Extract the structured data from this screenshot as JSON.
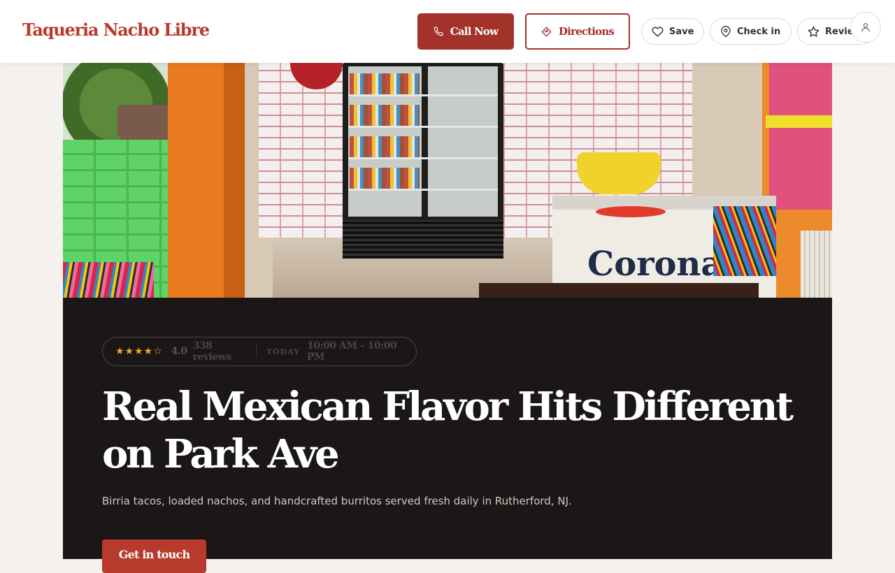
{
  "header": {
    "brand": "Taqueria Nacho Libre",
    "call_label": "Call Now",
    "directions_label": "Directions",
    "save_label": "Save",
    "checkin_label": "Check in",
    "review_label": "Review",
    "icons": {
      "call": "phone-icon",
      "directions": "directions-icon",
      "save": "heart-icon",
      "checkin": "map-pin-icon",
      "review": "star-icon",
      "account": "user-icon"
    }
  },
  "hero": {
    "photo_text": "Corona",
    "rating_stars": "★★★★☆",
    "rating_value": "4.0",
    "reviews_count": "338 reviews",
    "today_label": "TODAY",
    "hours": "10:00 AM – 10:00 PM",
    "headline": "Real Mexican Flavor Hits Different on Park Ave",
    "subheadline": "Birria tacos, loaded nachos, and handcrafted burritos served fresh daily in Rutherford, NJ.",
    "cta_label": "Get in touch"
  },
  "colors": {
    "brand": "#b83a2c",
    "primary_button": "#a3322b",
    "dark_section": "#1a1716",
    "star": "#f0a830"
  }
}
